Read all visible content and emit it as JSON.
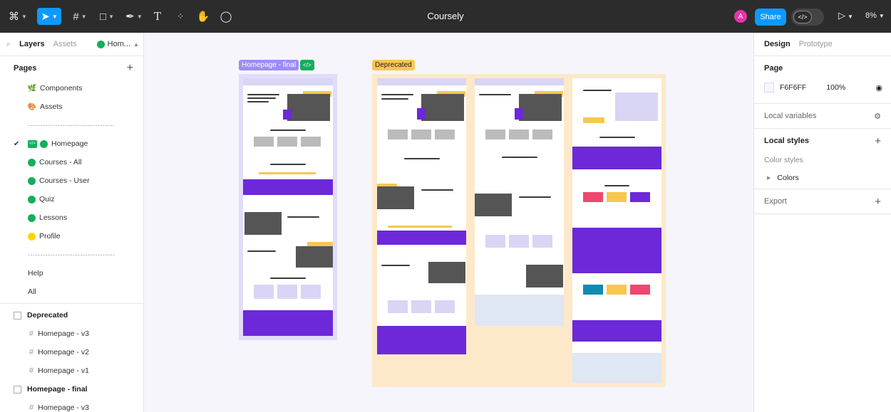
{
  "document": {
    "title": "Coursely"
  },
  "toolbar": {
    "tools": [
      "main-menu-icon",
      "move-tool-icon",
      "frame-tool-icon",
      "shape-tool-icon",
      "pen-tool-icon",
      "text-tool-icon",
      "resources-icon",
      "hand-tool-icon",
      "comment-icon"
    ],
    "avatar_initial": "A",
    "share_label": "Share",
    "zoom": "8%",
    "accent": "#0d99ff"
  },
  "left_panel": {
    "tabs": {
      "layers": "Layers",
      "assets": "Assets"
    },
    "current_page": "Hom...",
    "pages_label": "Pages",
    "pages": [
      {
        "label": "Components",
        "icon": "leaf-emoji-icon"
      },
      {
        "label": "Assets",
        "icon": "palette-emoji-icon"
      },
      {
        "label": "-----------------------------------",
        "separator": true
      },
      {
        "label": "Homepage",
        "icon": "green-dot",
        "selected": true,
        "dev": true
      },
      {
        "label": "Courses - All",
        "icon": "green-dot"
      },
      {
        "label": "Courses - User",
        "icon": "green-dot"
      },
      {
        "label": "Quiz",
        "icon": "green-dot"
      },
      {
        "label": "Lessons",
        "icon": "green-dot"
      },
      {
        "label": "Profile",
        "icon": "yellow-dot"
      },
      {
        "label": "-----------------------------------",
        "separator": true
      },
      {
        "label": "Help"
      },
      {
        "label": "All"
      }
    ],
    "layers": [
      {
        "label": "Deprecated",
        "children": [
          "Homepage - v3",
          "Homepage - v2",
          "Homepage - v1"
        ]
      },
      {
        "label": "Homepage - final",
        "children": [
          "Homepage - v3"
        ]
      }
    ]
  },
  "canvas": {
    "labels": {
      "final": "Homepage - final",
      "deprecated": "Deprecated",
      "dev_badge": "</>"
    },
    "frame_colors": {
      "final_label": "#9b8cf8",
      "deprecated_label": "#f9c74f",
      "deprecated_bg": "#fde9c9",
      "brand_purple": "#6c28d9"
    },
    "mock_headlines": [
      "Become a part of the smartest online community",
      "Our top rated courses",
      "Your future starts now",
      "Learning online has never been easier!",
      "Register now and enjoy your future!",
      "Client testimonials",
      "Browse through all our subjects",
      "Top courses",
      "Subjects",
      "Testimonials",
      "Start your free journey now!"
    ]
  },
  "right_panel": {
    "tabs": {
      "design": "Design",
      "prototype": "Prototype"
    },
    "page_label": "Page",
    "page_color": "F6F6FF",
    "page_opacity": "100%",
    "local_variables": "Local variables",
    "local_styles": "Local styles",
    "color_styles": "Color styles",
    "colors_group": "Colors",
    "export": "Export"
  }
}
